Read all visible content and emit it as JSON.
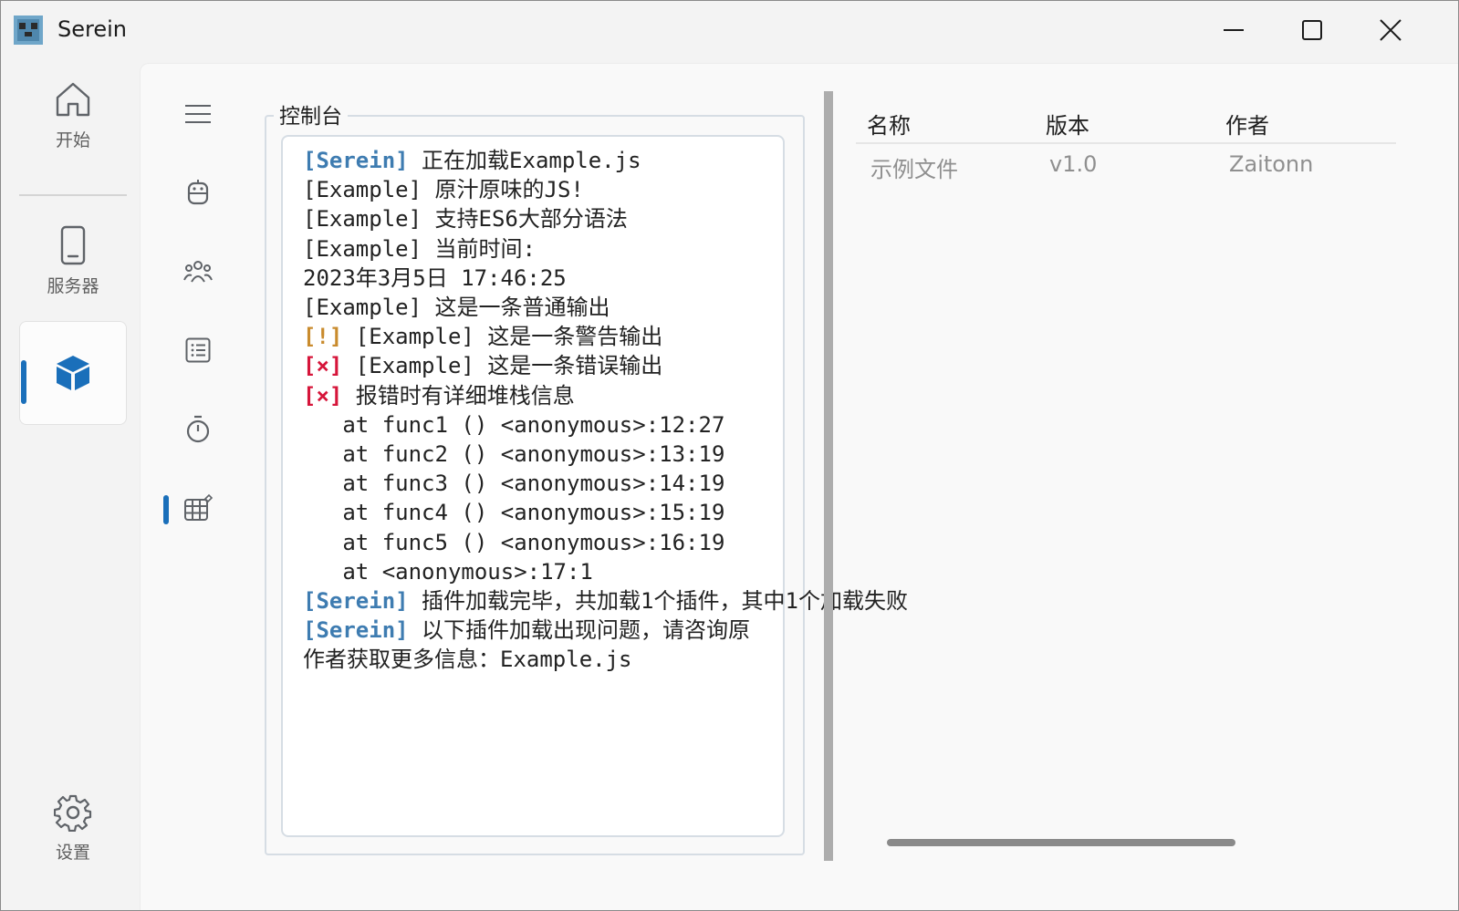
{
  "window": {
    "title": "Serein"
  },
  "nav": {
    "home_label": "开始",
    "server_label": "服务器",
    "settings_label": "设置"
  },
  "console": {
    "legend": "控制台",
    "lines": [
      {
        "tag": "[Serein]",
        "tag_type": "info",
        "text": " 正在加载Example.js"
      },
      {
        "tag": "",
        "tag_type": "",
        "text": "[Example] 原汁原味的JS!"
      },
      {
        "tag": "",
        "tag_type": "",
        "text": "[Example] 支持ES6大部分语法"
      },
      {
        "tag": "",
        "tag_type": "",
        "text": "[Example] 当前时间:"
      },
      {
        "tag": "",
        "tag_type": "",
        "text": "2023年3月5日 17:46:25"
      },
      {
        "tag": "",
        "tag_type": "",
        "text": "[Example] 这是一条普通输出"
      },
      {
        "tag": "[!]",
        "tag_type": "warn",
        "text": " [Example] 这是一条警告输出"
      },
      {
        "tag": "[×]",
        "tag_type": "err",
        "text": " [Example] 这是一条错误输出"
      },
      {
        "tag": "[×]",
        "tag_type": "err",
        "text": " 报错时有详细堆栈信息"
      },
      {
        "tag": "",
        "tag_type": "",
        "text": "   at func1 () <anonymous>:12:27"
      },
      {
        "tag": "",
        "tag_type": "",
        "text": "   at func2 () <anonymous>:13:19"
      },
      {
        "tag": "",
        "tag_type": "",
        "text": "   at func3 () <anonymous>:14:19"
      },
      {
        "tag": "",
        "tag_type": "",
        "text": "   at func4 () <anonymous>:15:19"
      },
      {
        "tag": "",
        "tag_type": "",
        "text": "   at func5 () <anonymous>:16:19"
      },
      {
        "tag": "",
        "tag_type": "",
        "text": "   at <anonymous>:17:1"
      },
      {
        "tag": "[Serein]",
        "tag_type": "info",
        "text": " 插件加载完毕，共加载1个插件，其中1个加载失败"
      },
      {
        "tag": "[Serein]",
        "tag_type": "info",
        "text": " 以下插件加载出现问题，请咨询原作者获取更多信息：Example.js"
      }
    ]
  },
  "plugins_table": {
    "headers": [
      "名称",
      "版本",
      "作者"
    ],
    "rows": [
      [
        "示例文件",
        "v1.0",
        "Zaitonn"
      ]
    ]
  },
  "colors": {
    "accent": "#1a6fba",
    "info_tag": "#3e7cb1",
    "warn_tag": "#c98b2d",
    "error_tag": "#d6153a"
  }
}
